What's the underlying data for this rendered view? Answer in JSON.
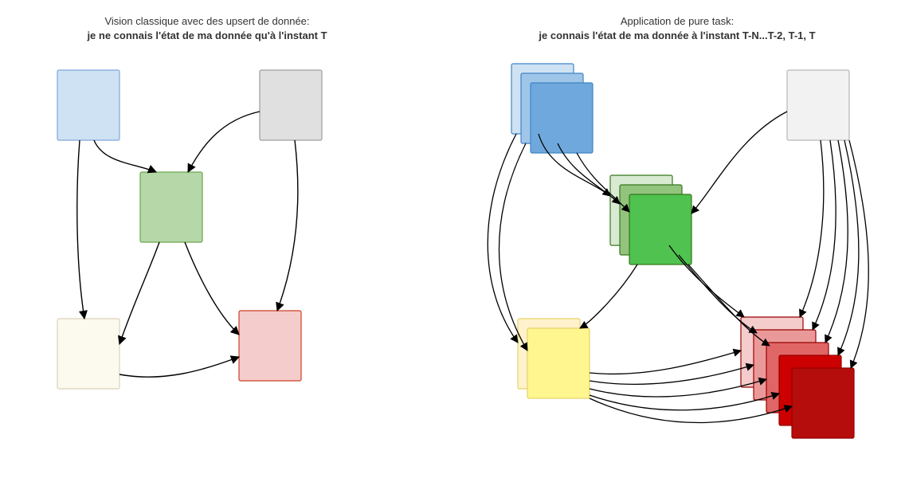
{
  "left": {
    "subtitle": "Vision classique avec des upsert de donnée:",
    "title": "je ne connais l'état de ma donnée qu'à l'instant T",
    "nodes": {
      "blue": {
        "fill": "#cfe2f3",
        "stroke": "#7da7d9"
      },
      "grey": {
        "fill": "#e0e0e0",
        "stroke": "#9e9e9e"
      },
      "green": {
        "fill": "#b6d7a8",
        "stroke": "#6aa84f"
      },
      "cream": {
        "fill": "#fcf9ef",
        "stroke": "#d9d2b8"
      },
      "pink": {
        "fill": "#f4cccc",
        "stroke": "#cc4125"
      }
    }
  },
  "right": {
    "subtitle": "Application de pure task:",
    "title": "je connais l'état de ma donnée à l'instant T-N...T-2, T-1, T",
    "stacks": {
      "blue": {
        "count": 3,
        "fills": [
          "#cfe2f3",
          "#9fc5e8",
          "#6fa8dc"
        ],
        "stroke": "#3d85c6"
      },
      "grey": {
        "count": 1,
        "fills": [
          "#f2f2f2"
        ],
        "stroke": "#b7b7b7"
      },
      "green": {
        "count": 3,
        "fills": [
          "#d9ead3",
          "#93c47d",
          "#4fc24f"
        ],
        "stroke": "#38761d"
      },
      "yellow": {
        "count": 2,
        "fills": [
          "#fff2cc",
          "#fff68f"
        ],
        "stroke": "#e6d36a"
      },
      "red": {
        "count": 5,
        "fills": [
          "#f4cccc",
          "#ea9999",
          "#e06666",
          "#cc0000",
          "#b50c0c"
        ],
        "stroke": "#990000"
      }
    }
  }
}
